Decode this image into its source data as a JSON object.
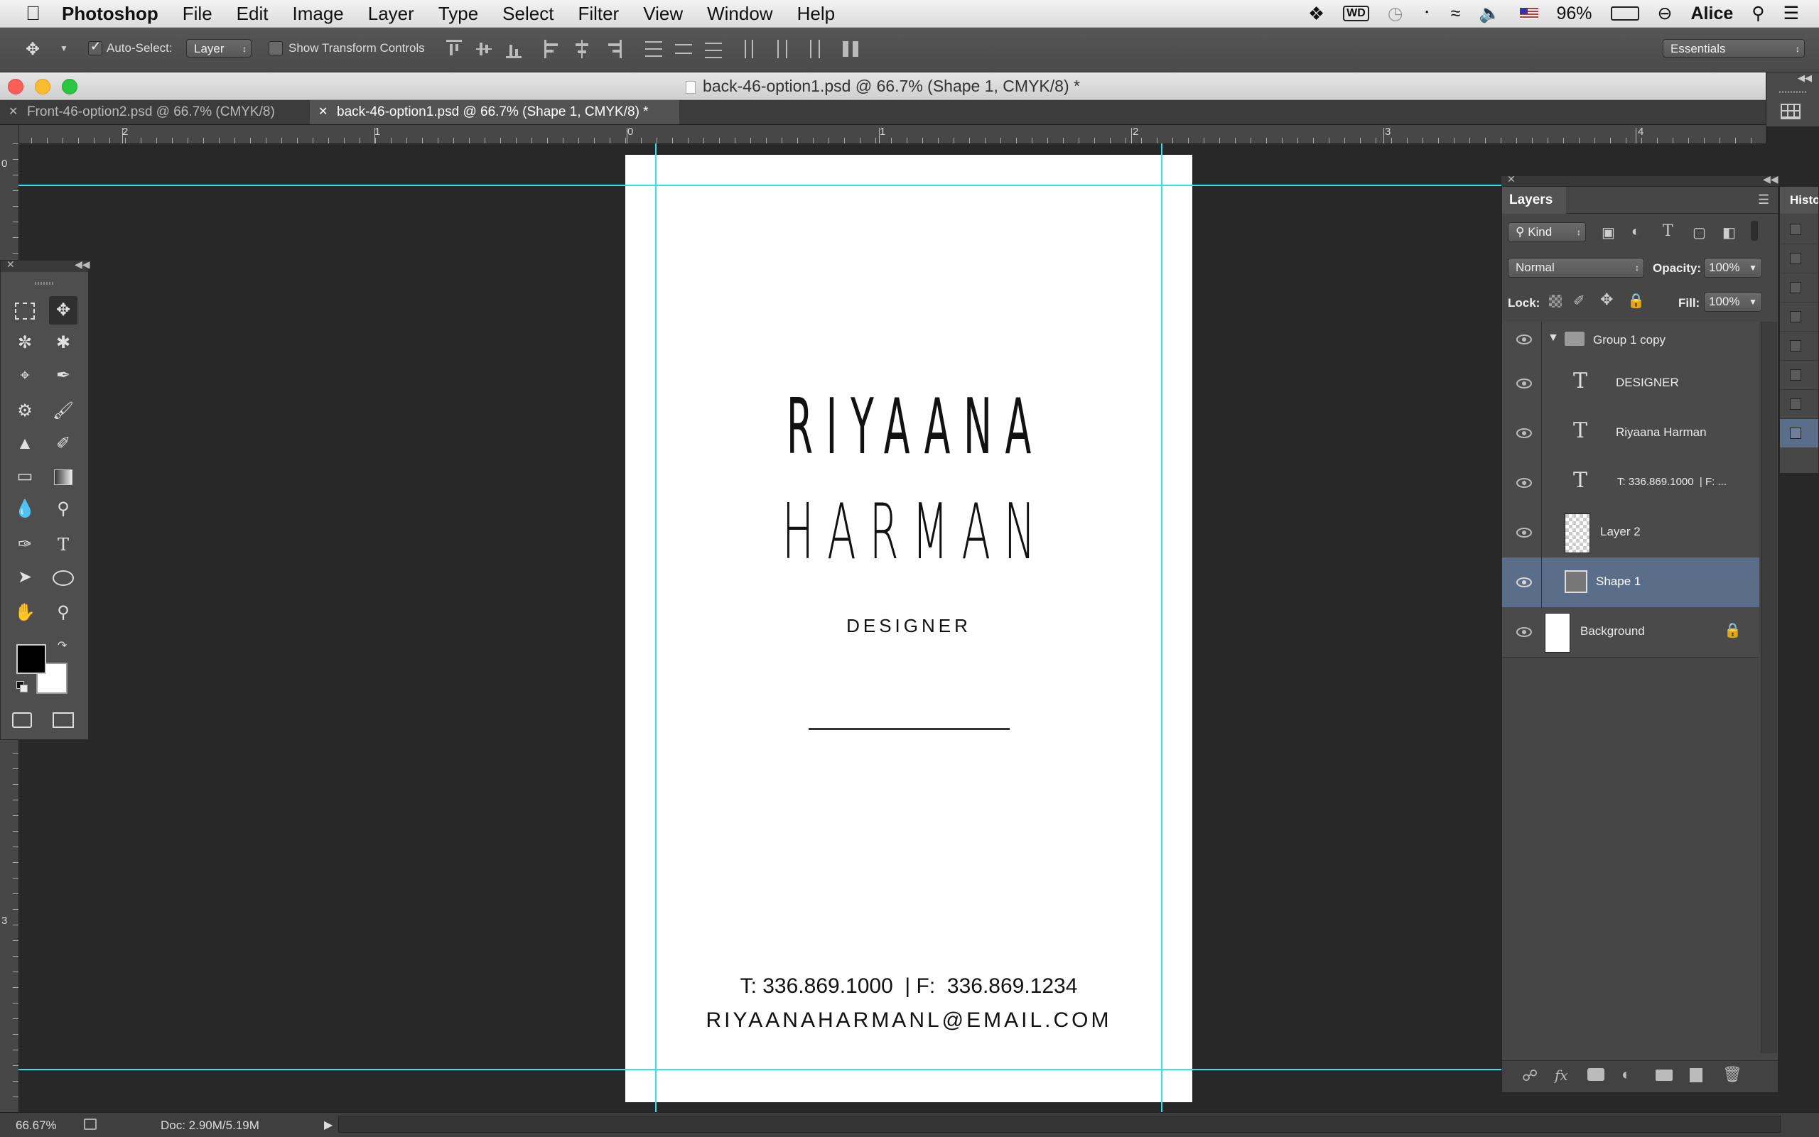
{
  "menubar": {
    "app_name": "Photoshop",
    "items": [
      "File",
      "Edit",
      "Image",
      "Layer",
      "Type",
      "Select",
      "Filter",
      "View",
      "Window",
      "Help"
    ],
    "battery": "96%",
    "user": "Alice"
  },
  "options_bar": {
    "auto_select_label": "Auto-Select:",
    "auto_select_value": "Layer",
    "show_transform_label": "Show Transform Controls",
    "workspace": "Essentials"
  },
  "window": {
    "title": "back-46-option1.psd @ 66.7% (Shape 1, CMYK/8) *"
  },
  "tabs": [
    {
      "label": "Front-46-option2.psd @ 66.7% (CMYK/8)"
    },
    {
      "label": "back-46-option1.psd @ 66.7% (Shape 1, CMYK/8) *"
    }
  ],
  "ruler": {
    "h_labels": [
      "2",
      "1",
      "0",
      "1",
      "2",
      "3",
      "4"
    ],
    "v_labels": [
      "0",
      "3"
    ]
  },
  "card": {
    "name_line1": "RIYAANA",
    "name_line2": "HARMAN",
    "title": "DESIGNER",
    "phone_line": "T: 336.869.1000  | F:  336.869.1234",
    "email_line": "RIYAANAHARMANL@EMAIL.COM"
  },
  "layers_panel": {
    "tab_label": "Layers",
    "filter_kind": "Kind",
    "blend_mode": "Normal",
    "opacity_label": "Opacity:",
    "opacity_value": "100%",
    "lock_label": "Lock:",
    "fill_label": "Fill:",
    "fill_value": "100%",
    "layers": [
      {
        "name": "Group 1 copy",
        "kind": "group",
        "selected": false
      },
      {
        "name": "DESIGNER",
        "kind": "text",
        "selected": false
      },
      {
        "name": "Riyaana Harman",
        "kind": "text",
        "selected": false
      },
      {
        "name": "T: 336.869.1000  | F: ...",
        "kind": "text",
        "selected": false
      },
      {
        "name": "Layer 2",
        "kind": "pixel",
        "selected": false
      },
      {
        "name": "Shape 1",
        "kind": "shape",
        "selected": true
      },
      {
        "name": "Background",
        "kind": "background",
        "selected": false
      }
    ]
  },
  "history_panel": {
    "tab_label": "Histo"
  },
  "status": {
    "zoom": "66.67%",
    "doc_size": "Doc: 2.90M/5.19M"
  },
  "colors": {
    "guide": "#35e1ef",
    "foreground": "#000000",
    "background": "#ffffff",
    "selected_layer": "#5a6d89"
  }
}
